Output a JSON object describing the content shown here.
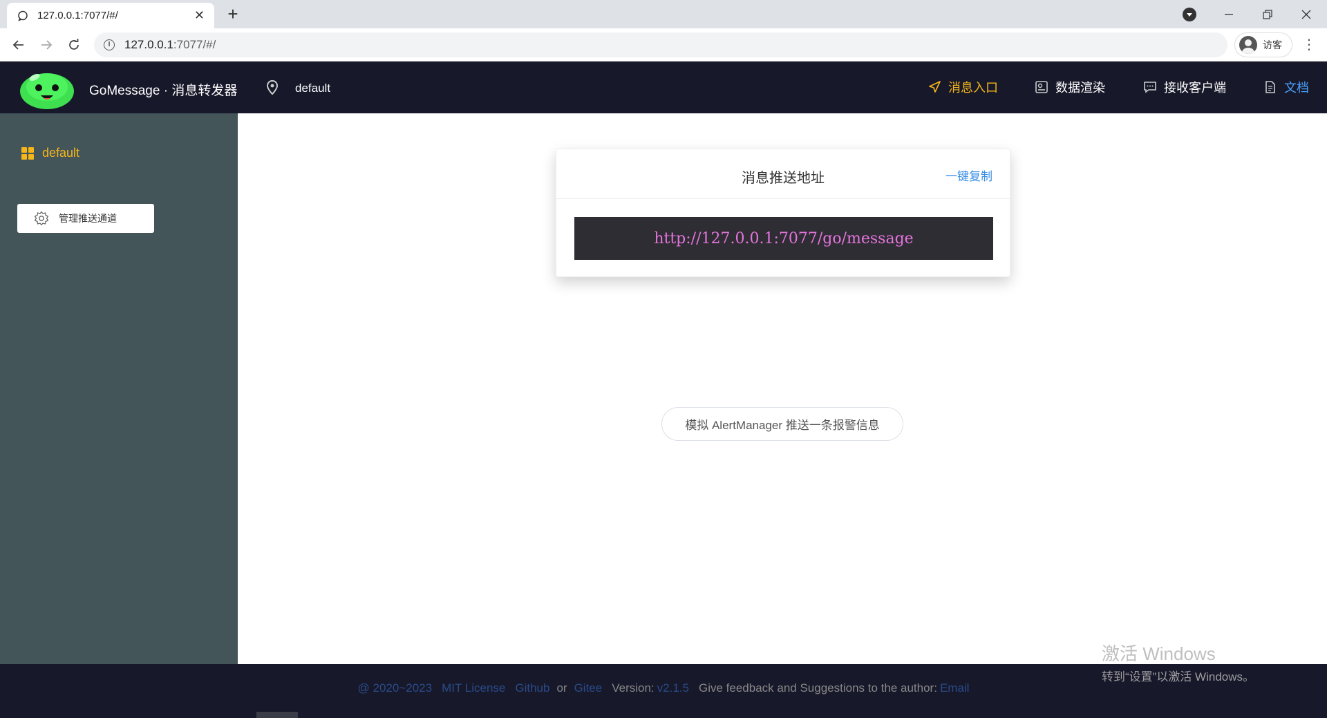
{
  "browser": {
    "tab_title": "127.0.0.1:7077/#/",
    "url_host": "127.0.0.1",
    "url_rest": ":7077/#/",
    "profile_label": "访客"
  },
  "header": {
    "brand": "GoMessage · 消息转发器",
    "location": "default",
    "nav": {
      "inbox": "消息入口",
      "render": "数据渲染",
      "clients": "接收客户端",
      "docs": "文档"
    }
  },
  "sidebar": {
    "title": "default",
    "manage_button": "管理推送通道"
  },
  "main": {
    "card_title": "消息推送地址",
    "copy_label": "一键复制",
    "push_url": "http://127.0.0.1:7077/go/message",
    "simulate_button": "模拟 AlertManager 推送一条报警信息"
  },
  "footer": {
    "copyright": "@ 2020~2023",
    "license": "MIT License",
    "github": "Github",
    "or": "or",
    "gitee": "Gitee",
    "version_label": "Version:",
    "version": "v2.1.5",
    "feedback": "Give feedback and Suggestions to the author:",
    "email": "Email"
  },
  "watermark": {
    "line1": "激活 Windows",
    "line2": "转到“设置”以激活 Windows。"
  },
  "colors": {
    "header_bg": "#17182a",
    "sidebar_bg": "#44555a",
    "accent": "#f5b619",
    "link": "#3a8ee6",
    "url_text": "#e574dc"
  }
}
